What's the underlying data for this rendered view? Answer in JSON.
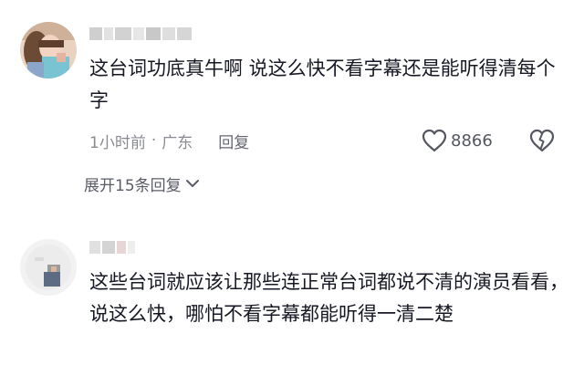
{
  "comments": [
    {
      "text": "这台词功底真牛啊 说这么快不看字幕还是能听得清每个字",
      "time": "1小时前",
      "separator": "·",
      "location": "广东",
      "reply_label": "回复",
      "like_count": "8866",
      "expand_replies": "展开15条回复",
      "icons": [
        "heart-outline-icon",
        "broken-heart-icon",
        "chevron-down-icon"
      ]
    },
    {
      "text": "这些台词就应该让那些连正常台词都说不清的演员看看，说这么快，哪怕不看字幕都能听得一清二楚"
    }
  ],
  "colors": {
    "text_primary": "#161823",
    "text_secondary": "#8a8b91",
    "icon": "#555760",
    "background": "#ffffff"
  }
}
